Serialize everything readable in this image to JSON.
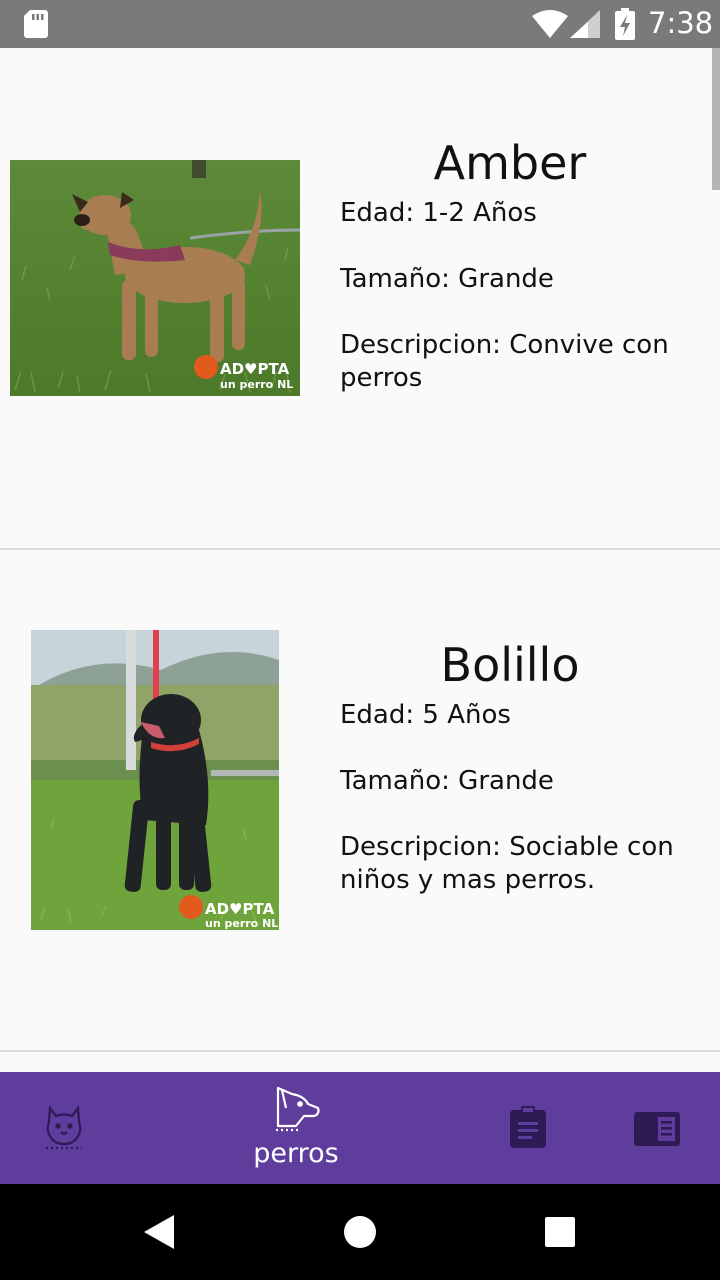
{
  "status_bar": {
    "time": "7:38",
    "icons": [
      "sd-card-icon",
      "wifi-icon",
      "signal-icon",
      "battery-charging-icon"
    ]
  },
  "dogs": [
    {
      "name": "Amber",
      "edad": "Edad: 1-2 Años",
      "tamano": "Tamaño: Grande",
      "descripcion_line1": "Descripcion: Convive con",
      "descripcion_line2": "perros",
      "photo_watermark_1": "AD♥PTA",
      "photo_watermark_2": "un perro NL"
    },
    {
      "name": "Bolillo",
      "edad": "Edad: 5 Años",
      "tamano": "Tamaño: Grande",
      "descripcion_line1": "Descripcion: Sociable con",
      "descripcion_line2": "niños y mas perros.",
      "photo_watermark_1": "AD♥PTA",
      "photo_watermark_2": "un perro NL"
    }
  ],
  "bottom_nav": {
    "items": [
      {
        "icon": "cat-icon",
        "label": ""
      },
      {
        "icon": "dog-icon",
        "label": "perros",
        "active": true
      },
      {
        "icon": "clipboard-icon",
        "label": ""
      },
      {
        "icon": "news-icon",
        "label": ""
      }
    ],
    "background": "#5e3d9d"
  },
  "system_nav": {
    "icons": [
      "back-icon",
      "home-icon",
      "recents-icon"
    ]
  }
}
